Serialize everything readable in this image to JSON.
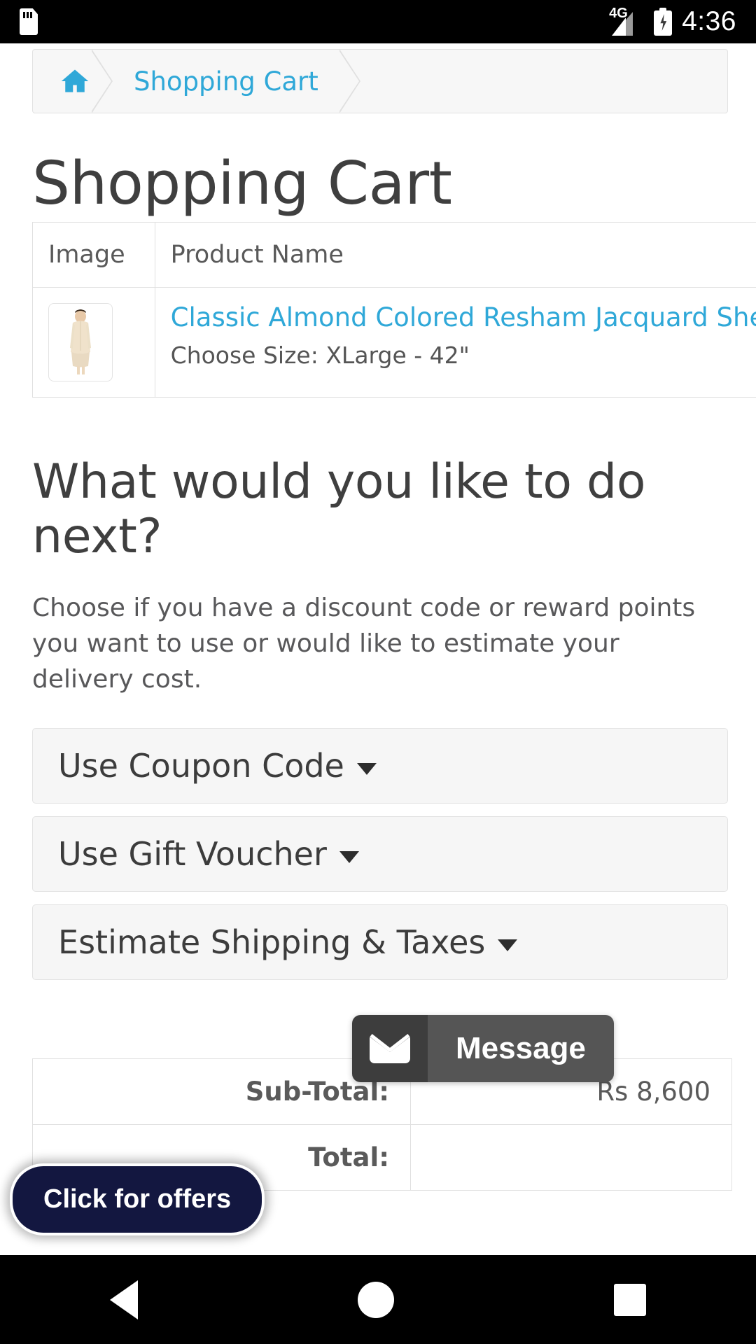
{
  "status_bar": {
    "sd_card_icon": "sd-card-icon",
    "network_label": "4G",
    "signal_icon": "signal-bars-icon",
    "battery_icon": "battery-charging-icon",
    "time": "4:36"
  },
  "breadcrumb": {
    "home_icon": "home-icon",
    "items": [
      {
        "label": "Shopping Cart"
      }
    ]
  },
  "page": {
    "title": "Shopping Cart"
  },
  "cart_table": {
    "headers": [
      "Image",
      "Product Name"
    ],
    "rows": [
      {
        "image_alt": "product-thumbnail-sherwani",
        "product_name": "Classic Almond Colored Resham Jacquard Sherwani",
        "option": "Choose Size: XLarge - 42\""
      }
    ]
  },
  "next_section": {
    "heading": "What would you like to do next?",
    "description": "Choose if you have a discount code or reward points you want to use or would like to estimate your delivery cost.",
    "panels": [
      {
        "label": "Use Coupon Code",
        "caret_icon": "chevron-down-icon"
      },
      {
        "label": "Use Gift Voucher",
        "caret_icon": "chevron-down-icon"
      },
      {
        "label": "Estimate Shipping & Taxes",
        "caret_icon": "chevron-down-icon"
      }
    ]
  },
  "totals": {
    "rows": [
      {
        "label": "Sub-Total:",
        "value": "Rs 8,600"
      },
      {
        "label": "Total:",
        "value": ""
      }
    ]
  },
  "offers_button": {
    "label": "Click for offers",
    "background": "#131740"
  },
  "message_widget": {
    "icon": "envelope-icon",
    "label": "Message",
    "background": "#555555"
  },
  "nav_bar": {
    "back_icon": "back-triangle-icon",
    "home_icon": "home-circle-icon",
    "recents_icon": "recents-square-icon"
  },
  "colors": {
    "link_blue": "#2fa8d8",
    "text_dark": "#3f3f3f",
    "text_muted": "#58585a",
    "panel_bg": "#f6f6f6",
    "border": "#e0e0e0"
  }
}
